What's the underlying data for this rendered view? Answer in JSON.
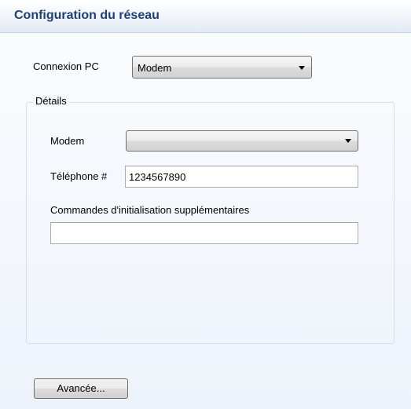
{
  "header": {
    "title": "Configuration du réseau"
  },
  "connection": {
    "label": "Connexion PC",
    "selected": "Modem"
  },
  "details": {
    "legend": "Détails",
    "modem_label": "Modem",
    "modem_selected": "",
    "phone_label": "Téléphone #",
    "phone_value": "1234567890",
    "init_label": "Commandes d'initialisation supplémentaires",
    "init_value": ""
  },
  "buttons": {
    "advanced_label": "Avancée..."
  },
  "colors": {
    "header_text": "#1e3f74",
    "panel_background": "#eef3fb",
    "group_border": "#d5dfe5"
  }
}
